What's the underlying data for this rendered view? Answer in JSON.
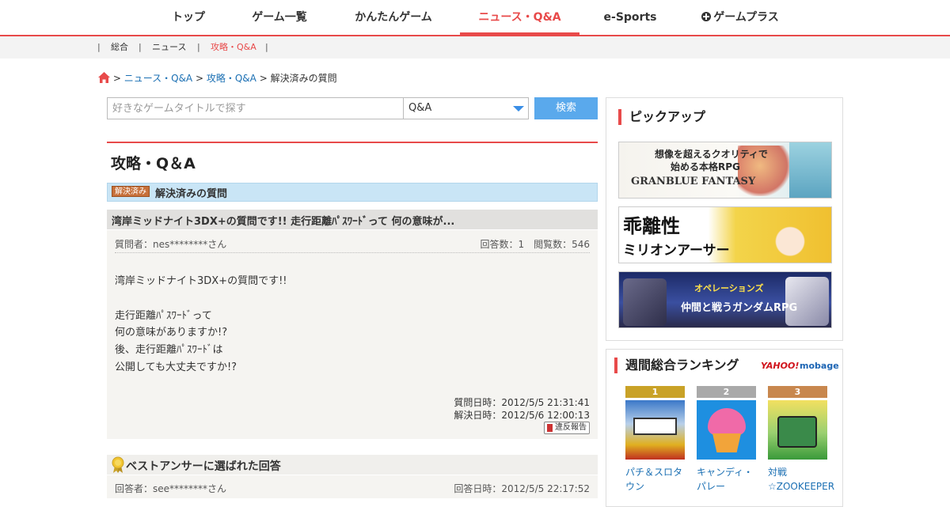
{
  "topnav": {
    "items": [
      {
        "label": "トップ"
      },
      {
        "label": "ゲーム一覧"
      },
      {
        "label": "かんたんゲーム"
      },
      {
        "label": "ニュース・Q&A"
      },
      {
        "label": "e-Sports"
      },
      {
        "label": "ゲームプラス"
      }
    ],
    "active_index": 3
  },
  "subnav": {
    "items": [
      {
        "label": "総合"
      },
      {
        "label": "ニュース"
      },
      {
        "label": "攻略・Q&A"
      }
    ],
    "separator": "|"
  },
  "breadcrumb": {
    "sep": ">",
    "news": "ニュース・Q&A",
    "qa": "攻略・Q&A",
    "current": "解決済みの質問"
  },
  "search": {
    "placeholder": "好きなゲームタイトルで探す",
    "category": "Q&A",
    "button": "検索"
  },
  "main": {
    "title": "攻略・Q＆A",
    "badge": "解決済み",
    "status": "解決済みの質問",
    "question": {
      "title": "湾岸ミッドナイト3DX+の質問です!! 走行距離ﾊﾟｽﾜｰﾄﾞって 何の意味が...",
      "asker": "質問者：nes********さん",
      "stats": "回答数：1　閲覧数：546",
      "lines": [
        "湾岸ミッドナイト3DX+の質問です!!",
        "",
        "走行距離ﾊﾟｽﾜｰﾄﾞって",
        "何の意味がありますか!?",
        "後、走行距離ﾊﾟｽﾜｰﾄﾞは",
        "公開しても大丈夫ですか!?"
      ],
      "asked_at": "質問日時：2012/5/5 21:31:41",
      "resolved_at": "解決日時：2012/5/6 12:00:13",
      "report": "違反報告"
    },
    "best_answer": {
      "heading": "ベストアンサーに選ばれた回答",
      "answerer": "回答者：see********さん",
      "answered_at": "回答日時：2012/5/5 22:17:52"
    }
  },
  "sidebar": {
    "pickup": {
      "heading": "ピックアップ",
      "banners": [
        {
          "line1": "想像を超えるクオリティで",
          "line2": "始める本格RPG",
          "line3": "GRANBLUE FANTASY"
        },
        {
          "line1": "乖離性",
          "line2": "ミリオンアーサー"
        },
        {
          "line1": "オペレーションズ",
          "line2": "仲間と戦うガンダムRPG"
        }
      ]
    },
    "ranking": {
      "heading": "週間総合ランキング",
      "yahoo": "YAHOO!",
      "mobage": "mobage",
      "items": [
        {
          "rank": "1",
          "name": "パチ＆スロタウン",
          "color": "#c9a227"
        },
        {
          "rank": "2",
          "name": "キャンディ・パレー",
          "color": "#a9a9a9"
        },
        {
          "rank": "3",
          "name": "対戦☆ZOOKEEPER",
          "color": "#c8874e"
        }
      ]
    }
  },
  "colors": {
    "accent": "#e84a4a",
    "link": "#1a6fb3",
    "search_button": "#5aa9ec",
    "status_bar": "#c9e5f6"
  }
}
